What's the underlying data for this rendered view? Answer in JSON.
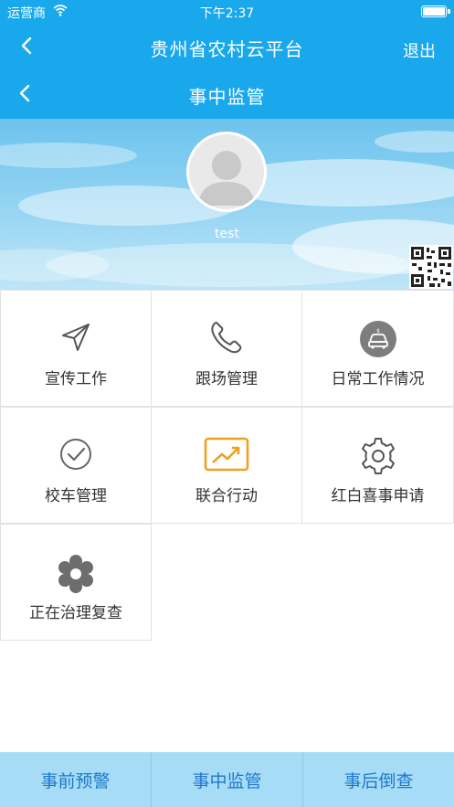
{
  "status_bar": {
    "carrier": "运营商",
    "time": "下午2:37"
  },
  "app_nav": {
    "title": "贵州省农村云平台",
    "logout_label": "退出"
  },
  "page_nav": {
    "title": "事中监管"
  },
  "profile": {
    "username": "test"
  },
  "menu": {
    "items": [
      {
        "label": "宣传工作",
        "icon": "send-arrow-icon"
      },
      {
        "label": "跟场管理",
        "icon": "phone-icon"
      },
      {
        "label": "日常工作情况",
        "icon": "car-circle-icon"
      },
      {
        "label": "校车管理",
        "icon": "check-circle-icon"
      },
      {
        "label": "联合行动",
        "icon": "trend-chart-icon"
      },
      {
        "label": "红白喜事申请",
        "icon": "gear-icon"
      },
      {
        "label": "正在治理复查",
        "icon": "flower-gear-icon"
      }
    ]
  },
  "tabbar": {
    "tabs": [
      {
        "label": "事前预警"
      },
      {
        "label": "事中监管"
      },
      {
        "label": "事后倒查"
      }
    ]
  },
  "colors": {
    "primary": "#1aa8ec",
    "tabbar_bg": "#a6dcf6",
    "tab_text": "#1f78c8",
    "accent_orange": "#f0a020"
  }
}
